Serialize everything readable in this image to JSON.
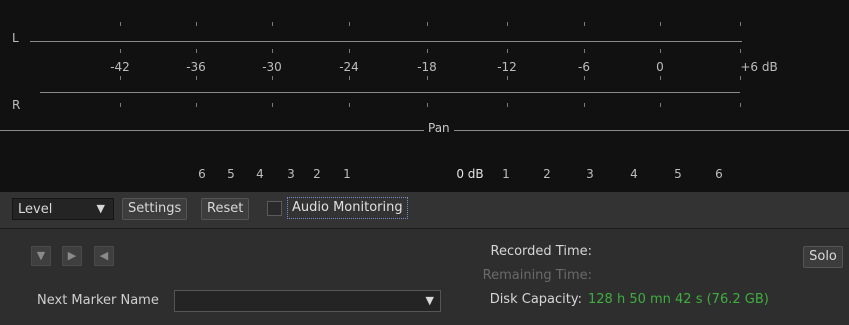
{
  "meter": {
    "left_label": "L",
    "right_label": "R",
    "db_scale": [
      "-42",
      "-36",
      "-30",
      "-24",
      "-18",
      "-12",
      "-6",
      "0",
      "+6 dB"
    ],
    "pan_label": "Pan",
    "pan_scale_left": [
      "6",
      "5",
      "4",
      "3",
      "2",
      "1"
    ],
    "pan_center": "0 dB",
    "pan_scale_right": [
      "1",
      "2",
      "3",
      "4",
      "5",
      "6"
    ]
  },
  "toolbar": {
    "mode_value": "Level",
    "settings_label": "Settings",
    "reset_label": "Reset",
    "audio_monitoring_label": "Audio Monitoring",
    "audio_monitoring_checked": false
  },
  "status": {
    "recorded_time_label": "Recorded Time:",
    "remaining_time_label": "Remaining Time:",
    "disk_capacity_label": "Disk Capacity:",
    "disk_capacity_value": "128 h 50 mn 42 s (76.2 GB)",
    "disk_capacity_color": "#3fae3f",
    "solo_label": "Solo",
    "next_marker_label": "Next Marker Name",
    "next_marker_value": ""
  },
  "icons": {
    "nav": [
      "arrow-down-icon",
      "play-right-icon",
      "play-left-icon"
    ]
  }
}
